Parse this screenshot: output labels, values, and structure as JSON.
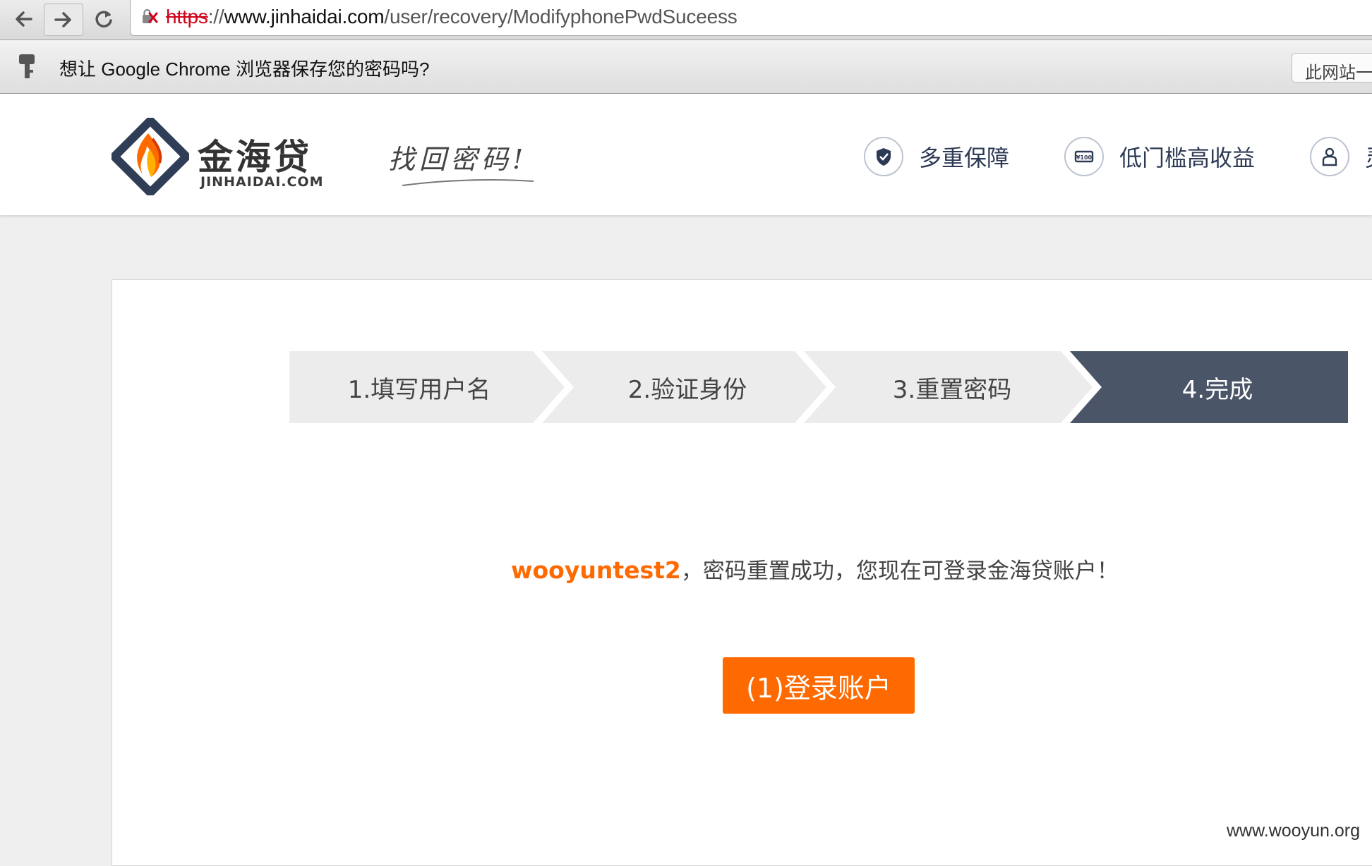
{
  "browser": {
    "url_scheme": "https",
    "url_sep": "://",
    "url_host": "www.jinhaidai.com",
    "url_path": "/user/recovery/ModifyphonePwdSuceess",
    "infobar_message": "想让 Google Chrome 浏览器保存您的密码吗?",
    "infobar_button": "此网站一"
  },
  "site": {
    "logo_cn": "金海贷",
    "logo_en": "JINHAIDAI.COM",
    "slogan": "找回密码!",
    "features": [
      "多重保障",
      "低门槛高收益",
      "灵"
    ]
  },
  "steps": [
    {
      "label": "1.填写用户名",
      "active": false
    },
    {
      "label": "2.验证身份",
      "active": false
    },
    {
      "label": "3.重置密码",
      "active": false
    },
    {
      "label": "4.完成",
      "active": true
    }
  ],
  "result": {
    "username": "wooyuntest2",
    "message": "，密码重置成功，您现在可登录金海贷账户！",
    "login_button": "(1)登录账户"
  },
  "watermark": "www.wooyun.org",
  "colors": {
    "accent": "#ff6a00",
    "step_active": "#4a5568",
    "step_inactive": "#ececec"
  }
}
